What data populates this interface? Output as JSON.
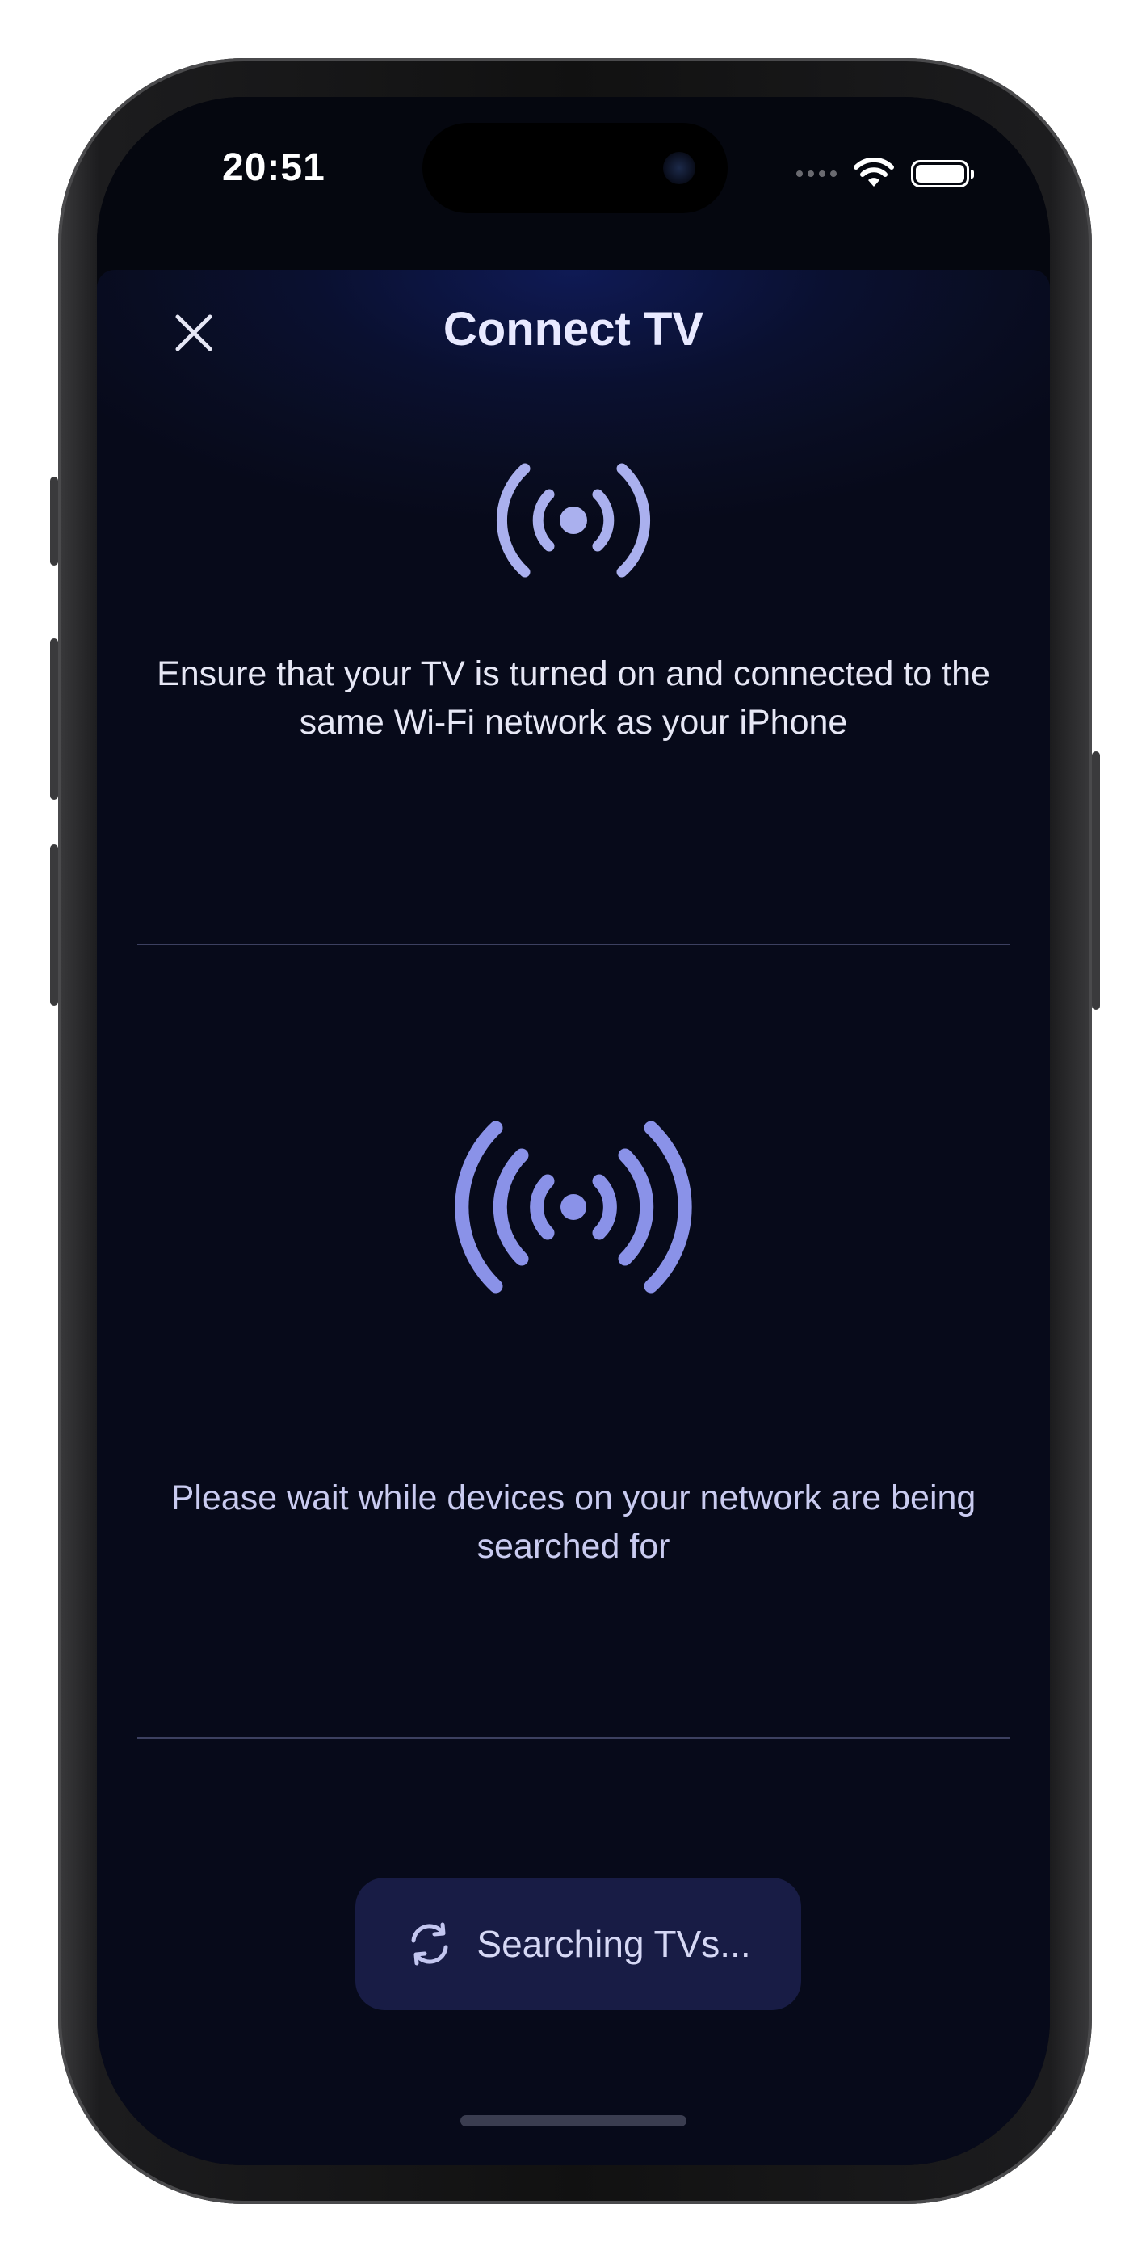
{
  "status_bar": {
    "time": "20:51",
    "signal_icon": "cellular-dots-icon",
    "wifi_icon": "wifi-icon",
    "battery_icon": "battery-icon"
  },
  "header": {
    "title": "Connect TV",
    "close_icon": "close-icon"
  },
  "intro": {
    "icon": "broadcast-icon",
    "text": "Ensure that your TV is turned on and connected to the same Wi-Fi network as your iPhone"
  },
  "search_section": {
    "icon": "broadcast-large-icon",
    "text": "Please wait while devices on your network are being searched for"
  },
  "search_button": {
    "icon": "refresh-icon",
    "label": "Searching TVs..."
  },
  "colors": {
    "background": "#070a1a",
    "accent": "#8a92e8",
    "button_bg": "#181c45",
    "text_primary": "#e8e9ff"
  }
}
